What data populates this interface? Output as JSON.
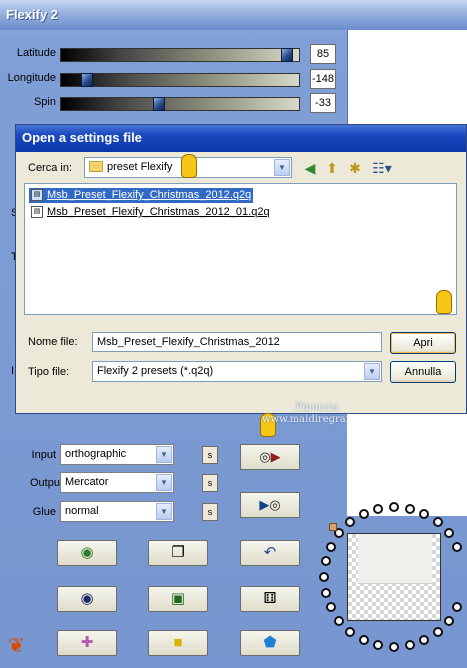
{
  "window": {
    "title": "Flexify 2"
  },
  "sliders": [
    {
      "label": "Latitude",
      "value": "85",
      "position": 0.95
    },
    {
      "label": "Longitude",
      "value": "-148",
      "position": 0.09
    },
    {
      "label": "Spin",
      "value": "-33",
      "position": 0.41
    }
  ],
  "partial_labels": [
    "S",
    "T",
    "I"
  ],
  "dialog": {
    "title": "Open a settings file",
    "look_in_label": "Cerca in:",
    "look_in_value": "preset Flexify",
    "files": [
      "Msb_Preset_Flexify_Christmas_2012.q2q",
      "Msb_Preset_Flexify_Christmas_2012_01.q2q"
    ],
    "filename_label": "Nome file:",
    "filename_value": "Msb_Preset_Flexify_Christmas_2012",
    "filetype_label": "Tipo file:",
    "filetype_value": "Flexify 2 presets (*.q2q)",
    "open_button": "Apri",
    "cancel_button": "Annulla"
  },
  "controls": {
    "input_label": "Input",
    "input_value": "orthographic",
    "output_label": "Output",
    "output_value": "Mercator",
    "glue_label": "Glue",
    "glue_value": "normal",
    "s_label": "s"
  },
  "watermark": {
    "line1": "Pinuccia",
    "line2": "www.maidiregrafica.eu"
  },
  "colors": {
    "window_bg": "#7f9fd6",
    "dialog_title": "#0a36a8",
    "selection": "#316ac5",
    "dialog_bg": "#ece9d8"
  }
}
